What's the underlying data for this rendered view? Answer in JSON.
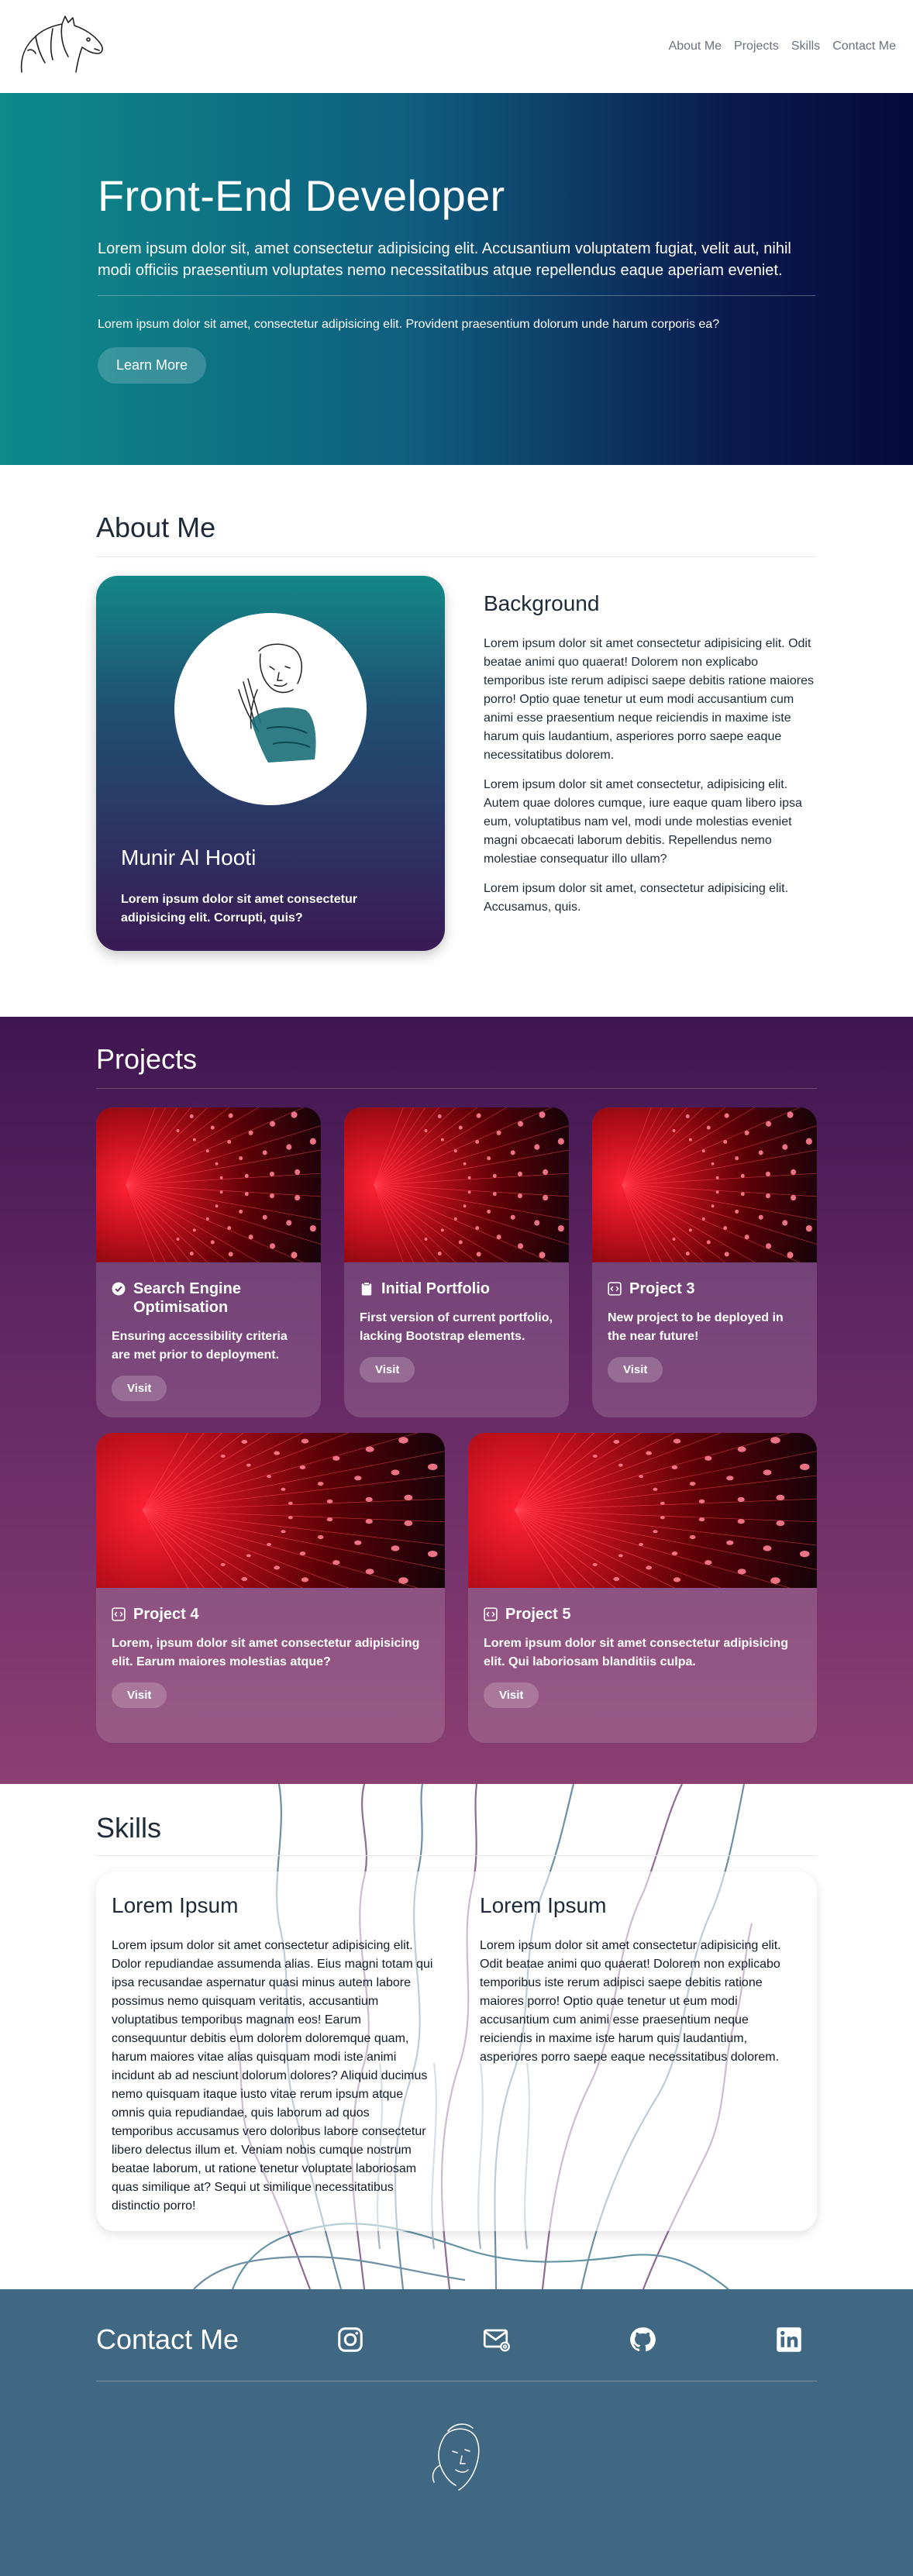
{
  "nav": {
    "logo": "horse-logo",
    "links": [
      "About Me",
      "Projects",
      "Skills",
      "Contact Me"
    ]
  },
  "hero": {
    "title": "Front-End Developer",
    "lead": "Lorem ipsum dolor sit, amet consectetur adipisicing elit. Accusantium voluptatem fugiat, velit aut, nihil modi officiis praesentium voluptates nemo necessitatibus atque repellendus eaque aperiam eveniet.",
    "sub": "Lorem ipsum dolor sit amet, consectetur adipisicing elit. Provident praesentium dolorum unde harum corporis ea?",
    "button": "Learn More"
  },
  "about": {
    "title": "About Me",
    "profile": {
      "name": "Munir Al Hooti",
      "text": "Lorem ipsum dolor sit amet consectetur adipisicing elit. Corrupti, quis?"
    },
    "background": {
      "heading": "Background",
      "paragraphs": [
        "Lorem ipsum dolor sit amet consectetur adipisicing elit. Odit beatae animi quo quaerat! Dolorem non explicabo temporibus iste rerum adipisci saepe debitis ratione maiores porro! Optio quae tenetur ut eum modi accusantium cum animi esse praesentium neque reiciendis in maxime iste harum quis laudantium, asperiores porro saepe eaque necessitatibus dolorem.",
        "Lorem ipsum dolor sit amet consectetur, adipisicing elit. Autem quae dolores cumque, iure eaque quam libero ipsa eum, voluptatibus nam vel, modi unde molestias eveniet magni obcaecati laborum debitis. Repellendus nemo molestiae consequatur illo ullam?",
        "Lorem ipsum dolor sit amet, consectetur adipisicing elit. Accusamus, quis."
      ]
    }
  },
  "projects": {
    "title": "Projects",
    "items": [
      {
        "title": "Search Engine Optimisation",
        "icon": "check-badge-icon",
        "desc": "Ensuring accessibility criteria are met prior to deployment.",
        "button": "Visit"
      },
      {
        "title": "Initial Portfolio",
        "icon": "clipboard-icon",
        "desc": "First version of current portfolio, lacking Bootstrap elements.",
        "button": "Visit"
      },
      {
        "title": "Project 3",
        "icon": "code-square-icon",
        "desc": "New project to be deployed in the near future!",
        "button": "Visit"
      },
      {
        "title": "Project 4",
        "icon": "code-square-icon",
        "desc": "Lorem, ipsum dolor sit amet consectetur adipisicing elit. Earum maiores molestias atque?",
        "button": "Visit"
      },
      {
        "title": "Project 5",
        "icon": "code-square-icon",
        "desc": "Lorem ipsum dolor sit amet consectetur adipisicing elit. Qui laboriosam blanditiis culpa.",
        "button": "Visit"
      }
    ]
  },
  "skills": {
    "title": "Skills",
    "columns": [
      {
        "heading": "Lorem Ipsum",
        "text": "Lorem ipsum dolor sit amet consectetur adipisicing elit. Dolor repudiandae assumenda alias. Eius magni totam qui ipsa recusandae aspernatur quasi minus autem labore possimus nemo quisquam veritatis, accusantium voluptatibus temporibus magnam eos! Earum consequuntur debitis eum dolorem doloremque quam, harum maiores vitae alias quisquam modi iste animi incidunt ab ad nesciunt dolorum dolores? Aliquid ducimus nemo quisquam itaque iusto vitae rerum ipsum atque omnis quia repudiandae, quis laborum ad quos temporibus accusamus vero doloribus labore consectetur libero delectus illum et. Veniam nobis cumque nostrum beatae laborum, ut ratione tenetur voluptate laboriosam quas similique at? Sequi ut similique necessitatibus distinctio porro!"
      },
      {
        "heading": "Lorem Ipsum",
        "text": "Lorem ipsum dolor sit amet consectetur adipisicing elit. Odit beatae animi quo quaerat! Dolorem non explicabo temporibus iste rerum adipisci saepe debitis ratione maiores porro! Optio quae tenetur ut eum modi accusantium cum animi esse praesentium neque reiciendis in maxime iste harum quis laudantium, asperiores porro saepe eaque necessitatibus dolorem."
      }
    ]
  },
  "contact": {
    "title": "Contact Me",
    "socials": [
      "instagram-icon",
      "email-icon",
      "github-icon",
      "linkedin-icon"
    ]
  },
  "colors": {
    "hero_start": "#0d8a8a",
    "hero_end": "#050a3c",
    "projects_top": "#3e1650",
    "projects_bottom": "#8b3f73",
    "contact_bg": "#416882"
  }
}
